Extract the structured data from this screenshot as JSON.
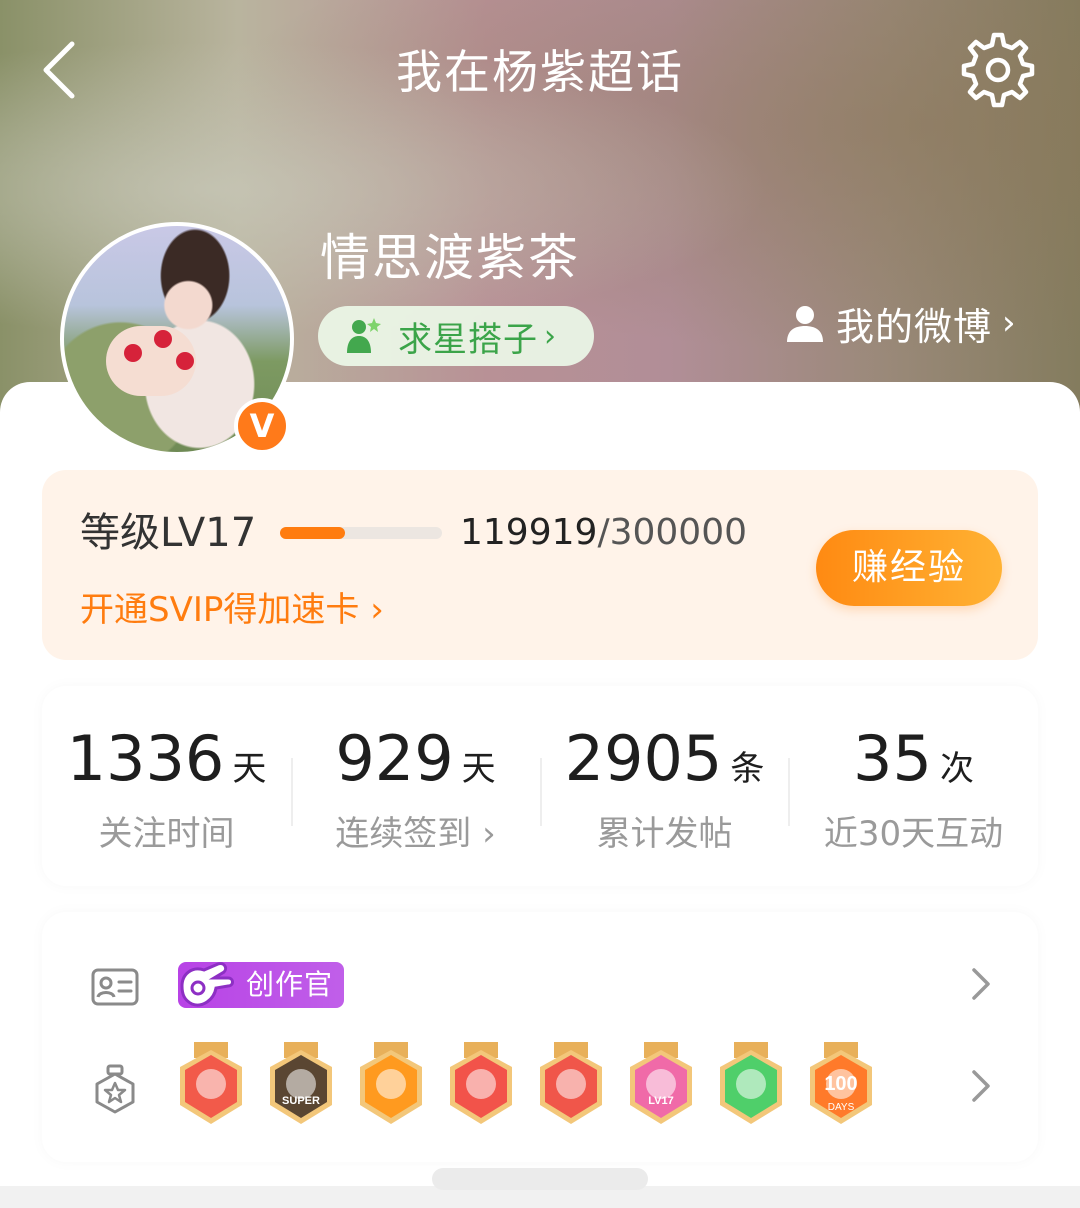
{
  "header": {
    "title": "我在杨紫超话",
    "back_icon": "chevron-left-icon",
    "settings_icon": "gear-icon"
  },
  "profile": {
    "username": "情思渡紫茶",
    "verified_badge": "V",
    "partner_pill": {
      "label": "求星搭子",
      "icon": "star-person-icon"
    },
    "my_weibo": {
      "label": "我的微博",
      "icon": "person-icon"
    }
  },
  "level": {
    "label": "等级LV17",
    "current": "119919",
    "separator": "/",
    "max": "300000",
    "progress_fraction": 0.4,
    "svip_link": "开通SVIP得加速卡",
    "earn_button": "赚经验",
    "accent_color": "#ff7c0f"
  },
  "stats": [
    {
      "value": "1336",
      "unit": "天",
      "label": "关注时间"
    },
    {
      "value": "929",
      "unit": "天",
      "label": "连续签到"
    },
    {
      "value": "2905",
      "unit": "条",
      "label": "累计发帖"
    },
    {
      "value": "35",
      "unit": "次",
      "label": "近30天互动"
    }
  ],
  "badges": {
    "id_row_icon": "id-card-icon",
    "creator_badge": "创作官",
    "medal_row_icon": "medal-icon",
    "medals": [
      {
        "name": "cartoon-dog-medal-icon",
        "color": "#f25a4a"
      },
      {
        "name": "super-medal-icon",
        "color": "#5a4632",
        "text": "SUPER"
      },
      {
        "name": "crown-medal-icon",
        "color": "#ff9a1f"
      },
      {
        "name": "cartoon-dog-medal-icon",
        "color": "#f2534a"
      },
      {
        "name": "dragon-medal-icon",
        "color": "#f0564a"
      },
      {
        "name": "lv17-medal-icon",
        "color": "#f06aa8",
        "text": "LV17"
      },
      {
        "name": "hand-medal-icon",
        "color": "#4fcf6a"
      },
      {
        "name": "100-days-medal-icon",
        "color": "#ff7a2a",
        "text": "100",
        "subtext": "DAYS"
      }
    ]
  }
}
